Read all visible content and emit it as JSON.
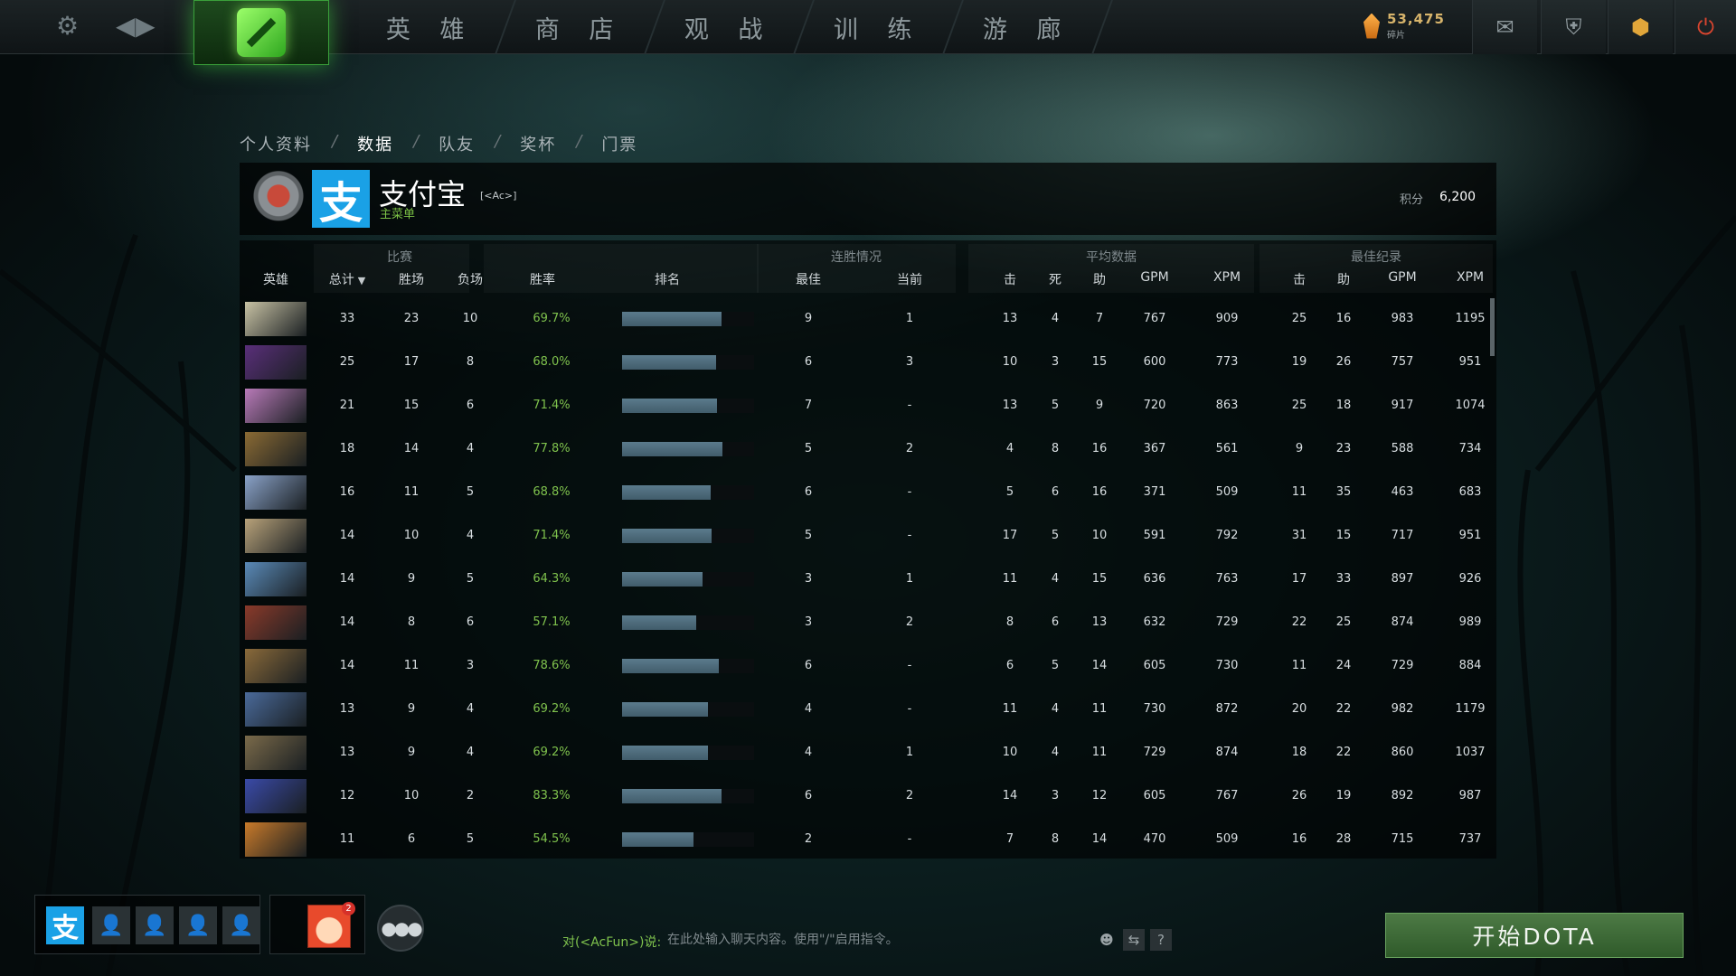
{
  "nav": {
    "tabs": [
      "英 雄",
      "商 店",
      "观 战",
      "训 练",
      "游 廊"
    ]
  },
  "shards": {
    "amount": "53,475",
    "label": "碎片"
  },
  "breadcrumb": [
    "个人资料",
    "数据",
    "队友",
    "奖杯",
    "门票"
  ],
  "breadcrumb_sep": "/",
  "player": {
    "avatar_text": "支",
    "name": "支付宝",
    "tag": "[<Ac>]",
    "subtitle": "主菜单",
    "score_label": "积分",
    "score_value": "6,200"
  },
  "table": {
    "groups": {
      "matches": "比赛",
      "streaks": "连胜情况",
      "averages": "平均数据",
      "records": "最佳纪录"
    },
    "columns": {
      "hero": "英雄",
      "total": "总计",
      "wins": "胜场",
      "losses": "负场",
      "winrate": "胜率",
      "rank": "排名",
      "best": "最佳",
      "current": "当前",
      "avg_k": "击",
      "avg_d": "死",
      "avg_a": "助",
      "avg_gpm": "GPM",
      "avg_xpm": "XPM",
      "best_k": "击",
      "best_a": "助",
      "best_gpm": "GPM",
      "best_xpm": "XPM"
    },
    "rows": [
      {
        "total": "33",
        "wins": "23",
        "losses": "10",
        "winrate": "69.7%",
        "rank": 0.75,
        "best": "9",
        "current": "1",
        "k": "13",
        "d": "4",
        "a": "7",
        "gpm": "767",
        "xpm": "909",
        "bk": "25",
        "ba": "16",
        "bgpm": "983",
        "bxpm": "1195"
      },
      {
        "total": "25",
        "wins": "17",
        "losses": "8",
        "winrate": "68.0%",
        "rank": 0.71,
        "best": "6",
        "current": "3",
        "k": "10",
        "d": "3",
        "a": "15",
        "gpm": "600",
        "xpm": "773",
        "bk": "19",
        "ba": "26",
        "bgpm": "757",
        "bxpm": "951"
      },
      {
        "total": "21",
        "wins": "15",
        "losses": "6",
        "winrate": "71.4%",
        "rank": 0.72,
        "best": "7",
        "current": "-",
        "k": "13",
        "d": "5",
        "a": "9",
        "gpm": "720",
        "xpm": "863",
        "bk": "25",
        "ba": "18",
        "bgpm": "917",
        "bxpm": "1074"
      },
      {
        "total": "18",
        "wins": "14",
        "losses": "4",
        "winrate": "77.8%",
        "rank": 0.76,
        "best": "5",
        "current": "2",
        "k": "4",
        "d": "8",
        "a": "16",
        "gpm": "367",
        "xpm": "561",
        "bk": "9",
        "ba": "23",
        "bgpm": "588",
        "bxpm": "734"
      },
      {
        "total": "16",
        "wins": "11",
        "losses": "5",
        "winrate": "68.8%",
        "rank": 0.67,
        "best": "6",
        "current": "-",
        "k": "5",
        "d": "6",
        "a": "16",
        "gpm": "371",
        "xpm": "509",
        "bk": "11",
        "ba": "35",
        "bgpm": "463",
        "bxpm": "683"
      },
      {
        "total": "14",
        "wins": "10",
        "losses": "4",
        "winrate": "71.4%",
        "rank": 0.68,
        "best": "5",
        "current": "-",
        "k": "17",
        "d": "5",
        "a": "10",
        "gpm": "591",
        "xpm": "792",
        "bk": "31",
        "ba": "15",
        "bgpm": "717",
        "bxpm": "951"
      },
      {
        "total": "14",
        "wins": "9",
        "losses": "5",
        "winrate": "64.3%",
        "rank": 0.61,
        "best": "3",
        "current": "1",
        "k": "11",
        "d": "4",
        "a": "15",
        "gpm": "636",
        "xpm": "763",
        "bk": "17",
        "ba": "33",
        "bgpm": "897",
        "bxpm": "926"
      },
      {
        "total": "14",
        "wins": "8",
        "losses": "6",
        "winrate": "57.1%",
        "rank": 0.56,
        "best": "3",
        "current": "2",
        "k": "8",
        "d": "6",
        "a": "13",
        "gpm": "632",
        "xpm": "729",
        "bk": "22",
        "ba": "25",
        "bgpm": "874",
        "bxpm": "989"
      },
      {
        "total": "14",
        "wins": "11",
        "losses": "3",
        "winrate": "78.6%",
        "rank": 0.73,
        "best": "6",
        "current": "-",
        "k": "6",
        "d": "5",
        "a": "14",
        "gpm": "605",
        "xpm": "730",
        "bk": "11",
        "ba": "24",
        "bgpm": "729",
        "bxpm": "884"
      },
      {
        "total": "13",
        "wins": "9",
        "losses": "4",
        "winrate": "69.2%",
        "rank": 0.65,
        "best": "4",
        "current": "-",
        "k": "11",
        "d": "4",
        "a": "11",
        "gpm": "730",
        "xpm": "872",
        "bk": "20",
        "ba": "22",
        "bgpm": "982",
        "bxpm": "1179"
      },
      {
        "total": "13",
        "wins": "9",
        "losses": "4",
        "winrate": "69.2%",
        "rank": 0.65,
        "best": "4",
        "current": "1",
        "k": "10",
        "d": "4",
        "a": "11",
        "gpm": "729",
        "xpm": "874",
        "bk": "18",
        "ba": "22",
        "bgpm": "860",
        "bxpm": "1037"
      },
      {
        "total": "12",
        "wins": "10",
        "losses": "2",
        "winrate": "83.3%",
        "rank": 0.75,
        "best": "6",
        "current": "2",
        "k": "14",
        "d": "3",
        "a": "12",
        "gpm": "605",
        "xpm": "767",
        "bk": "26",
        "ba": "19",
        "bgpm": "892",
        "bxpm": "987"
      },
      {
        "total": "11",
        "wins": "6",
        "losses": "5",
        "winrate": "54.5%",
        "rank": 0.54,
        "best": "2",
        "current": "-",
        "k": "7",
        "d": "8",
        "a": "14",
        "gpm": "470",
        "xpm": "509",
        "bk": "16",
        "ba": "28",
        "bgpm": "715",
        "bxpm": "737"
      }
    ],
    "hero_colors": [
      "#c8c2a4",
      "#5a2f7a",
      "#b87ab8",
      "#8a6a34",
      "#8aa2c8",
      "#b8a27a",
      "#5a8ab8",
      "#8a3a2a",
      "#8a6a3a",
      "#4a6a9a",
      "#7a6a4a",
      "#3a4aa8",
      "#c87a2a"
    ]
  },
  "party": {
    "avatar_text": "支",
    "friend_badge": "2"
  },
  "chat": {
    "target": "对(<AcFun>)说:",
    "placeholder": "在此处输入聊天内容。使用\"/\"启用指令。",
    "help": "?"
  },
  "play_button": "开始DOTA"
}
